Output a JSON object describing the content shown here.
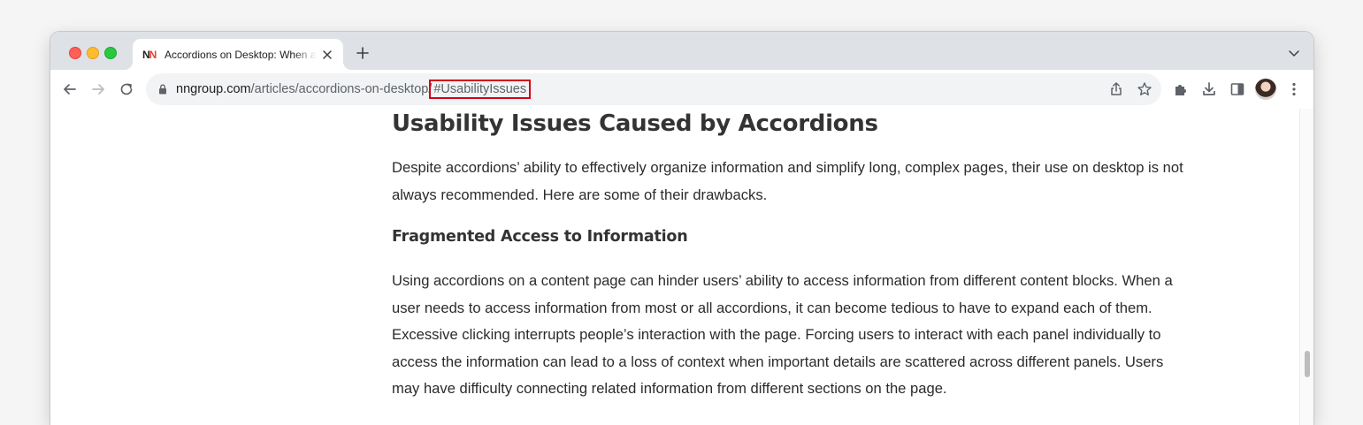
{
  "browser": {
    "tab": {
      "favicon_text": "NN",
      "title": "Accordions on Desktop: When and How to Use"
    },
    "address": {
      "host": "nngroup.com",
      "path": "/articles/accordions-on-desktop/",
      "anchor": "#UsabilityIssues"
    },
    "icons": {
      "back": "back-arrow-icon",
      "forward": "forward-arrow-icon",
      "reload": "reload-icon",
      "lock": "lock-icon",
      "share": "share-icon",
      "bookmark": "star-icon",
      "extensions": "puzzle-icon",
      "downloads": "download-icon",
      "side_panel": "side-panel-icon",
      "menu": "kebab-menu-icon"
    },
    "highlight_color": "#d0021b"
  },
  "article": {
    "heading": "Usability Issues Caused by Accordions",
    "intro_lines": [
      "Despite accordions’ ability to effectively organize information and simplify long, complex pages, their use on desktop is not",
      "always recommended. Here are some of their drawbacks."
    ],
    "subheading": "Fragmented Access to Information",
    "body_lines": [
      "Using accordions on a content page can hinder users’ ability to access information from different content blocks. When a",
      "user needs to access information from most or all accordions, it can become tedious to have to expand each of them.",
      "Excessive clicking interrupts people’s interaction with the page. Forcing users to interact with each panel individually to",
      "access the information can lead to a loss of context when important details are scattered across different panels. Users",
      "may have difficulty connecting related information from different sections on the page."
    ]
  }
}
